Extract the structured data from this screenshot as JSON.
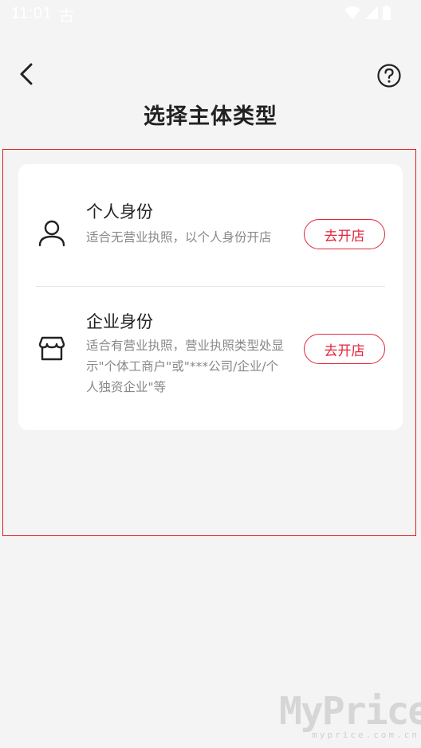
{
  "status_bar": {
    "time": "11:01",
    "extra_glyph": "古"
  },
  "header": {
    "title": "选择主体类型"
  },
  "options": [
    {
      "title": "个人身份",
      "description": "适合无营业执照，以个人身份开店",
      "button_label": "去开店",
      "icon": "person-icon"
    },
    {
      "title": "企业身份",
      "description": "适合有营业执照，营业执照类型处显示\"个体工商户\"或\"***公司/企业/个人独资企业\"等",
      "button_label": "去开店",
      "icon": "store-icon"
    }
  ],
  "colors": {
    "accent": "#e5243b",
    "highlight_border": "#e02020",
    "background": "#f4f4f4"
  },
  "watermark": {
    "main": "MyPrice",
    "sub": "myprice.com.cn"
  }
}
